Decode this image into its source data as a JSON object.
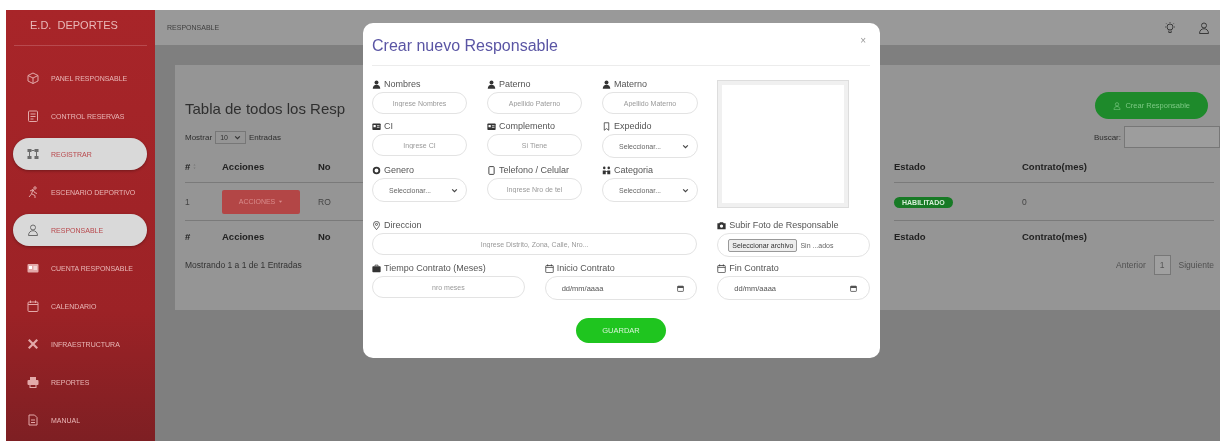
{
  "sidebar": {
    "brand": "E.D.  DEPORTES",
    "items": [
      {
        "label": "PANEL RESPONSABLE",
        "selected": false
      },
      {
        "label": "CONTROL RESERVAS",
        "selected": false
      },
      {
        "label": "REGISTRAR",
        "selected": true
      },
      {
        "label": "ESCENARIO DEPORTIVO",
        "selected": false
      },
      {
        "label": "RESPONSABLE",
        "selected": true
      },
      {
        "label": "CUENTA RESPONSABLE",
        "selected": false
      },
      {
        "label": "CALENDARIO",
        "selected": false
      },
      {
        "label": "INFRAESTRUCTURA",
        "selected": false
      },
      {
        "label": "REPORTES",
        "selected": false
      },
      {
        "label": "MANUAL",
        "selected": false
      }
    ]
  },
  "topbar": {
    "title": "RESPONSABLE"
  },
  "content": {
    "title": "Tabla de todos los Resp",
    "create_button": "Crear Responsable",
    "length": {
      "before": "Mostrar",
      "value": "10",
      "after": "Entradas"
    },
    "search_label": "Buscar:",
    "header_left": [
      "#",
      "Acciones",
      "No"
    ],
    "header_right": [
      "Estado",
      "Contrato(mes)"
    ],
    "row": {
      "number": "1",
      "actions": "ACCIONES",
      "name": "RO",
      "status": "HABILITADO",
      "contract": "0"
    },
    "footer_left": [
      "#",
      "Acciones",
      "No"
    ],
    "footer_right": [
      "Estado",
      "Contrato(mes)"
    ],
    "info": "Mostrando 1 a 1 de 1 Entradas",
    "pagination": {
      "previous": "Anterior",
      "page": "1",
      "next": "Siguiente"
    }
  },
  "modal": {
    "title": "Crear nuevo Responsable",
    "close": "×",
    "fields": [
      {
        "label": "Nombres",
        "kind": "text",
        "placeholder": "Ingrese Nombres"
      },
      {
        "label": "Paterno",
        "kind": "text",
        "placeholder": "Apellido Paterno"
      },
      {
        "label": "Materno",
        "kind": "text",
        "placeholder": "Apellido Materno"
      },
      {
        "label": "CI",
        "kind": "text",
        "placeholder": "Ingrese CI"
      },
      {
        "label": "Complemento",
        "kind": "text",
        "placeholder": "Si Tiene"
      },
      {
        "label": "Expedido",
        "kind": "select",
        "value": "Seleccionar..."
      },
      {
        "label": "Genero",
        "kind": "select",
        "value": "Seleccionar..."
      },
      {
        "label": "Telefono / Celular",
        "kind": "text",
        "placeholder": "Ingrese Nro de tel"
      },
      {
        "label": "Categoria",
        "kind": "select",
        "value": "Seleccionar..."
      }
    ],
    "address": {
      "label": "Direccion",
      "kind": "text",
      "placeholder": "Ingrese Distrito, Zona, Calle, Nro..."
    },
    "photo": {
      "label": "Subir Foto de Responsable",
      "button": "Seleccionar archivo",
      "status": "Sin ...ados"
    },
    "contract_fields": [
      {
        "label": "Tiempo Contrato (Meses)",
        "kind": "text",
        "placeholder": "nro meses"
      },
      {
        "label": "Inicio Contrato",
        "kind": "date",
        "value": "dd/mm/aaaa"
      },
      {
        "label": "Fin Contrato",
        "kind": "date",
        "value": "dd/mm/aaaa"
      }
    ],
    "submit": "GUARDAR"
  }
}
